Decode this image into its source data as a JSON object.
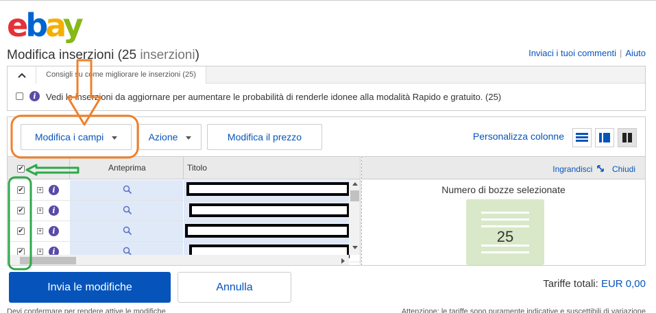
{
  "brand": {
    "letters": [
      "e",
      "b",
      "a",
      "y"
    ]
  },
  "header": {
    "title_prefix": "Modifica inserzioni (",
    "title_count": "25",
    "title_suffix_muted": " inserzioni",
    "title_close": ")",
    "feedback_link": "Inviaci i tuoi commenti",
    "separator": "|",
    "help_link": "Aiuto"
  },
  "tips_panel": {
    "collapse_glyph": "^",
    "tab_label": "Consigli su come migliorare le inserzioni (25)",
    "message": "Vedi le inserzioni da aggiornare per aumentare le probabilità di renderle idonee alla modalità Rapido e gratuito. (25)"
  },
  "toolbar": {
    "edit_fields": "Modifica i campi",
    "action": "Azione",
    "edit_price": "Modifica il prezzo",
    "customize_columns": "Personalizza colonne",
    "view_icons": [
      "list-dense-icon",
      "list-split-icon",
      "columns-icon"
    ]
  },
  "grid": {
    "col_preview": "Anteprima",
    "col_title": "Titolo",
    "row_count_visible": 4
  },
  "side_panel": {
    "expand_link": "Ingrandisci",
    "close_link": "Chiudi",
    "selected_label": "Numero di bozze selezionate",
    "selected_count": "25"
  },
  "actions": {
    "submit": "Invia le modifiche",
    "cancel": "Annulla",
    "fees_label": "Tariffe totali: ",
    "fees_value": "EUR 0,00"
  },
  "footer": {
    "left_note": "Devi confermare per rendere attive le modifiche",
    "right_note": "Attenzione: le tariffe sono puramente indicative e suscettibili di variazione"
  },
  "colors": {
    "ebay_red": "#e53238",
    "ebay_blue": "#0064d2",
    "ebay_yellow": "#f5af02",
    "ebay_green": "#86b817",
    "link_blue": "#0654ba",
    "annotation_orange": "#f0802a",
    "annotation_green": "#2ea84a"
  }
}
